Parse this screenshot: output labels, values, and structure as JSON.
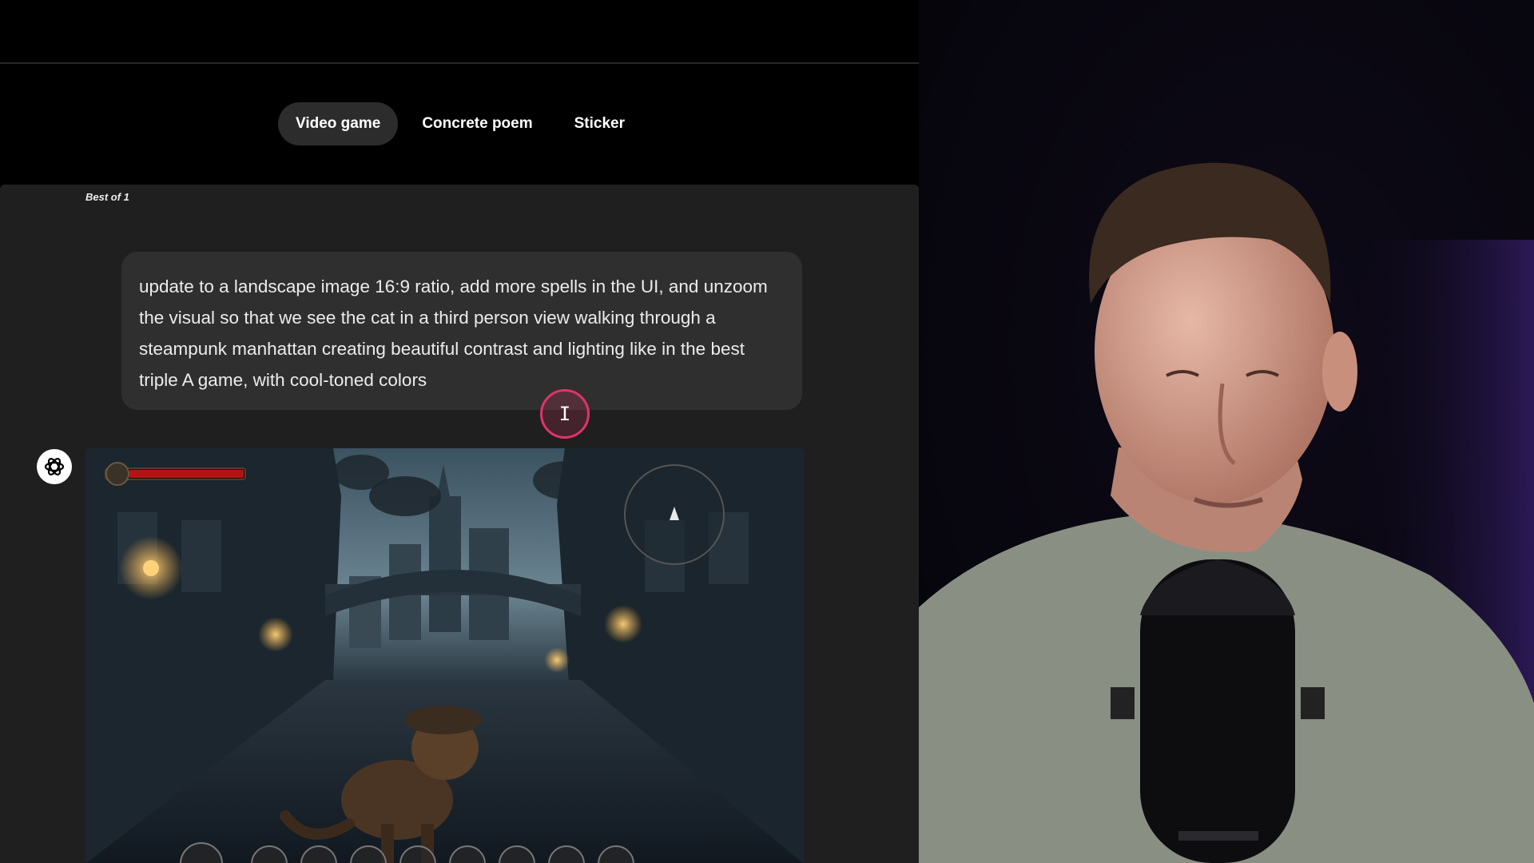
{
  "tabs": [
    {
      "label": "Video game",
      "active": true
    },
    {
      "label": "Concrete poem",
      "active": false
    },
    {
      "label": "Sticker",
      "active": false
    }
  ],
  "chat": {
    "best_of": "Best of 1",
    "prompt_text": "update to a landscape image 16:9 ratio, add more spells in the UI, and unzoom the visual so that we see the cat in a third person view walking through a steampunk manhattan creating beautiful contrast and lighting like in the best triple A game, with cool-toned colors"
  },
  "icons": {
    "assistant": "openai-logo-icon",
    "cursor": "text-cursor-icon"
  },
  "colors": {
    "background": "#000000",
    "chat_panel": "#1f1f1f",
    "bubble": "#2f2f2f",
    "cursor_highlight": "#e0336a",
    "health_bar": "#b01515"
  },
  "generated_image": {
    "subject": "cat in a deerstalker hat walking through a steampunk city street at dusk",
    "health": 1.0
  },
  "webcam": {
    "subject": "presenter speaking into a microphone"
  }
}
